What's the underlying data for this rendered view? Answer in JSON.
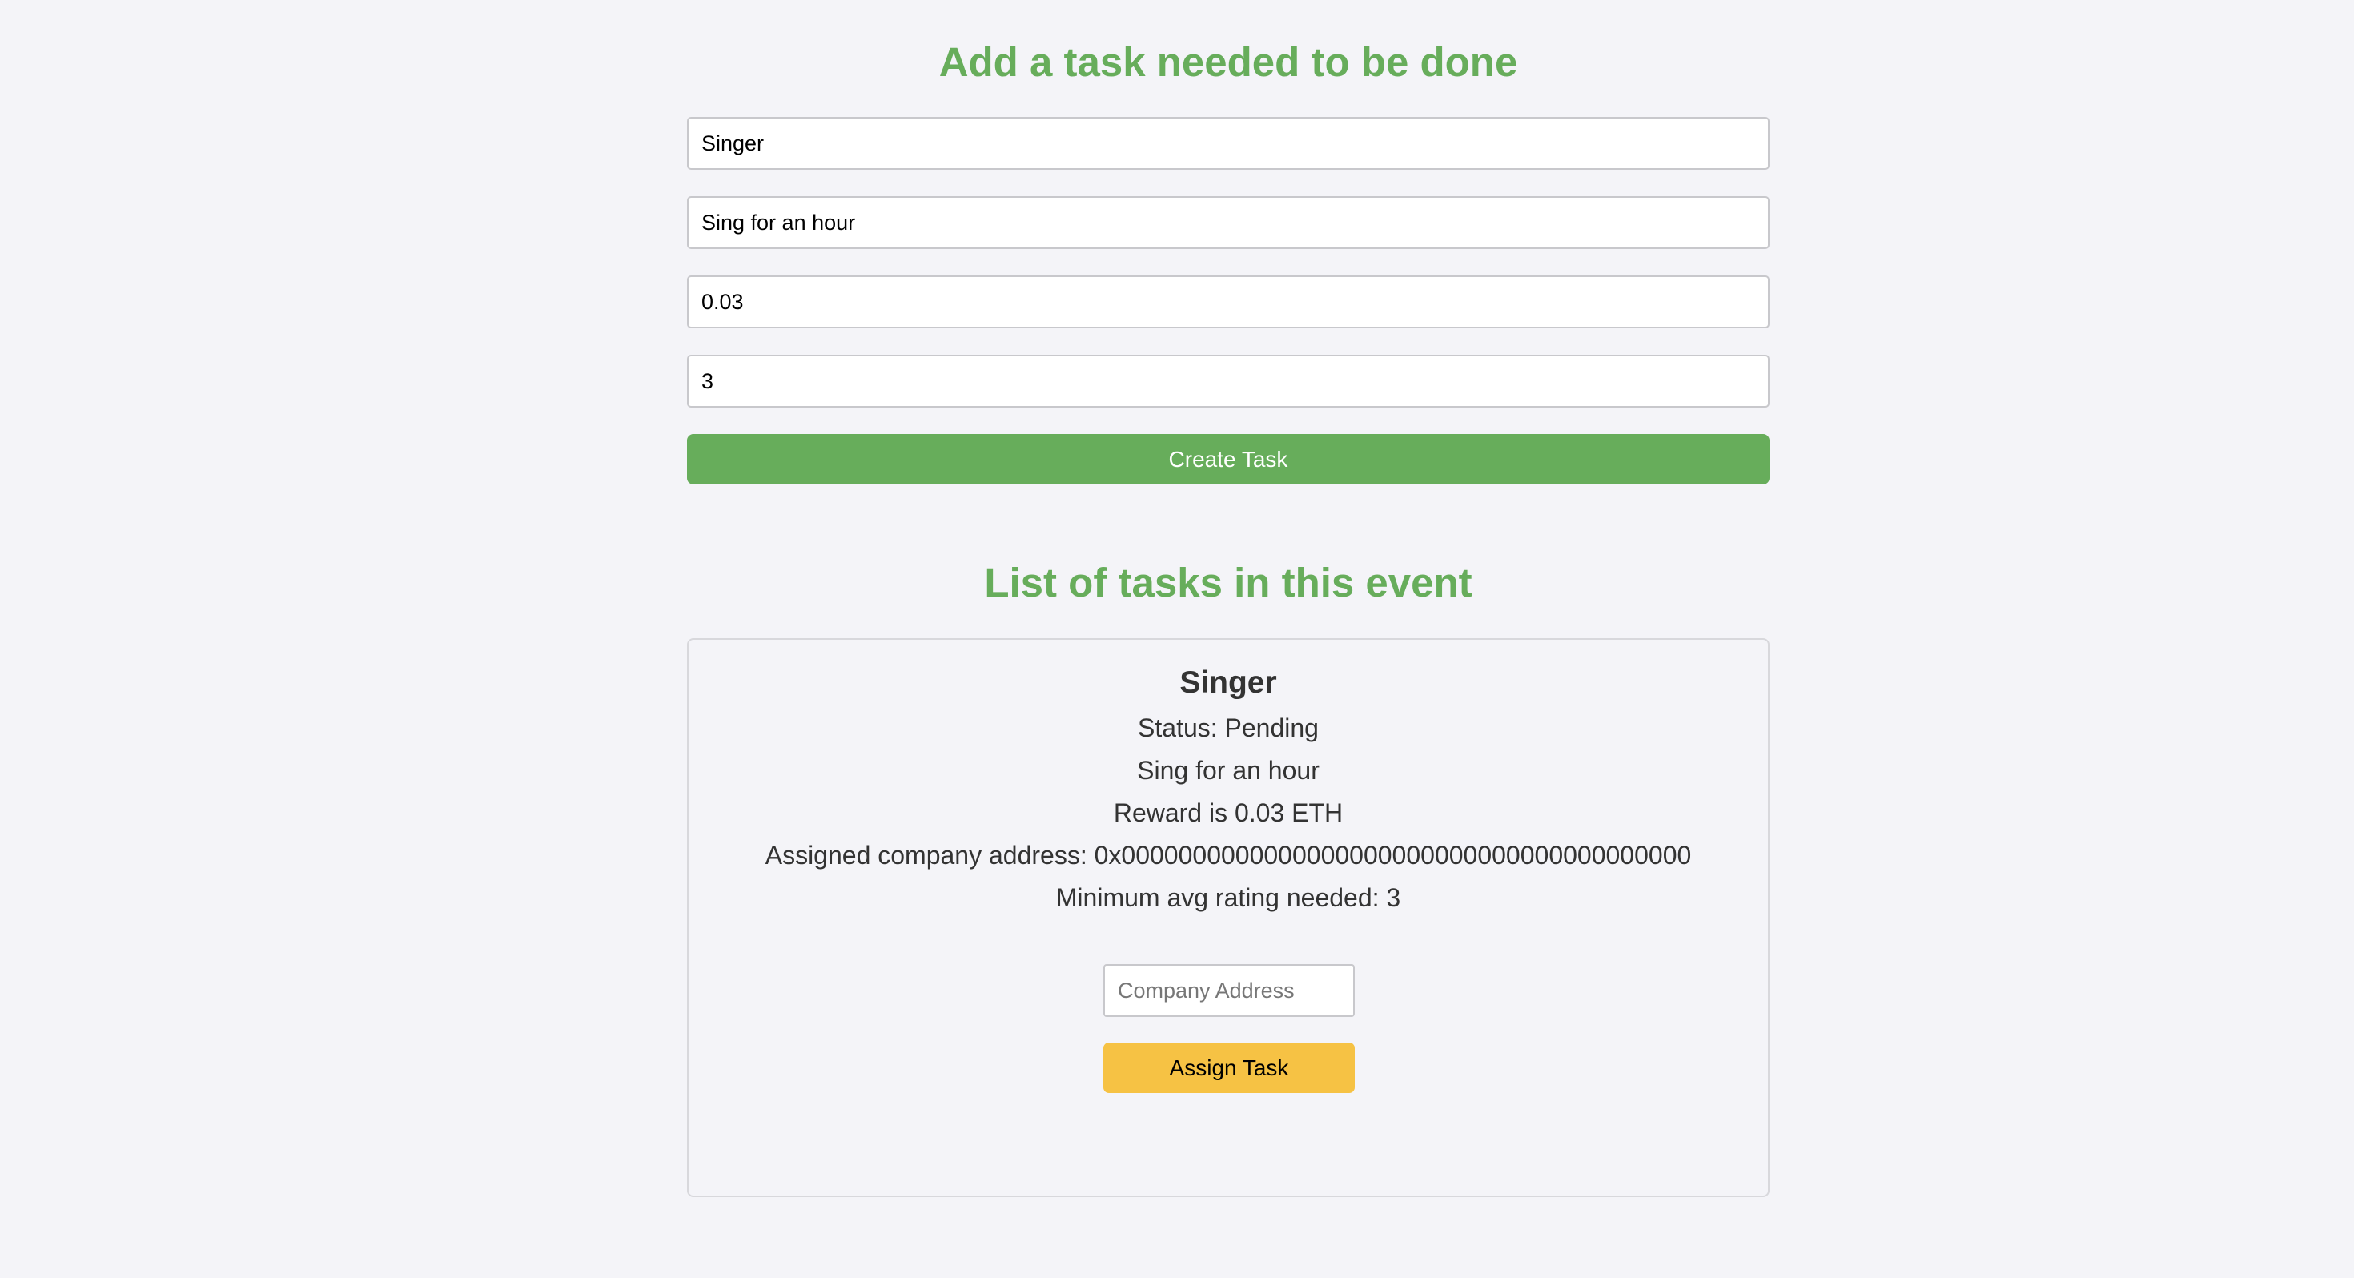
{
  "add_section": {
    "title": "Add a task needed to be done",
    "fields": [
      {
        "value": "Singer"
      },
      {
        "value": "Sing for an hour"
      },
      {
        "value": "0.03"
      },
      {
        "value": "3"
      }
    ],
    "create_label": "Create Task"
  },
  "list_section": {
    "title": "List of tasks in this event",
    "tasks": [
      {
        "name": "Singer",
        "status": "Status: Pending",
        "description": "Sing for an hour",
        "reward": "Reward is 0.03 ETH",
        "assigned": "Assigned company address: 0x0000000000000000000000000000000000000000",
        "min_rating": "Minimum avg rating needed: 3",
        "company_placeholder": "Company Address",
        "assign_label": "Assign Task"
      }
    ]
  },
  "colors": {
    "background": "#f4f4f8",
    "accent_green": "#67ad5b",
    "assign_yellow": "#f6c244"
  }
}
